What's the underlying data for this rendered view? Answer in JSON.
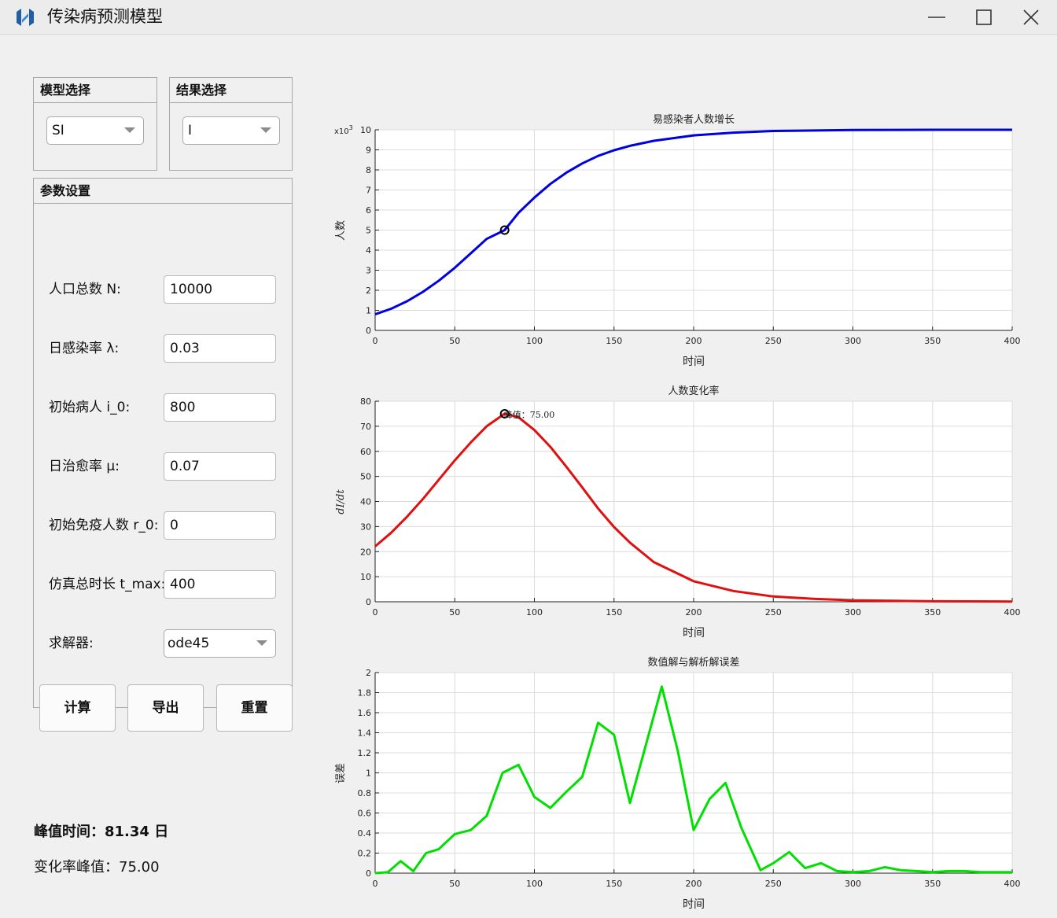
{
  "window": {
    "title": "传染病预测模型",
    "icon": "app-logo-icon"
  },
  "model_panel": {
    "title": "模型选择",
    "selected": "SI"
  },
  "result_panel": {
    "title": "结果选择",
    "selected": "I"
  },
  "params": {
    "title": "参数设置",
    "fields": [
      {
        "label": "人口总数 N:",
        "value": "10000"
      },
      {
        "label": "日感染率 λ:",
        "value": "0.03"
      },
      {
        "label": "初始病人 i_0:",
        "value": "800"
      },
      {
        "label": "日治愈率 μ:",
        "value": "0.07"
      },
      {
        "label": "初始免疫人数 r_0:",
        "value": "0"
      },
      {
        "label": "仿真总时长 t_max:",
        "value": "400"
      }
    ],
    "solver": {
      "label": "求解器:",
      "value": "ode45"
    }
  },
  "buttons": {
    "compute": "计算",
    "export": "导出",
    "reset": "重置"
  },
  "results": {
    "peak_time": "峰值时间：81.34 日",
    "peak_rate": "变化率峰值：75.00"
  },
  "colors": {
    "blue_line": "#0000e0",
    "red_line": "#e01010",
    "green_line": "#00e000",
    "grid": "#dcdcdc"
  },
  "chart_data": [
    {
      "type": "line",
      "title": "易感染者人数增长",
      "xlabel": "时间",
      "ylabel": "人数",
      "y_exponent": "x10",
      "y_exponent_power": "3",
      "xlim": [
        0,
        400
      ],
      "ylim": [
        0,
        10
      ],
      "xticks": [
        "0",
        "50",
        "100",
        "150",
        "200",
        "250",
        "300",
        "350",
        "400"
      ],
      "yticks": [
        "0",
        "1",
        "2",
        "3",
        "4",
        "5",
        "6",
        "7",
        "8",
        "9",
        "10"
      ],
      "grid": true,
      "series": [
        {
          "color": "#0000e0",
          "x": [
            0,
            10,
            20,
            30,
            40,
            50,
            60,
            70,
            81.34,
            90,
            100,
            110,
            120,
            130,
            140,
            150,
            160,
            175,
            200,
            225,
            250,
            300,
            350,
            400
          ],
          "y": [
            0.8,
            1.08,
            1.45,
            1.92,
            2.48,
            3.12,
            3.84,
            4.56,
            5.0,
            5.86,
            6.62,
            7.3,
            7.86,
            8.32,
            8.7,
            8.98,
            9.2,
            9.45,
            9.72,
            9.86,
            9.94,
            9.99,
            10.0,
            10.0
          ]
        }
      ],
      "marker": {
        "x": 81.34,
        "y": 5.0
      }
    },
    {
      "type": "line",
      "title": "人数变化率",
      "xlabel": "时间",
      "ylabel": "dI/dt",
      "xlim": [
        0,
        400
      ],
      "ylim": [
        0,
        80
      ],
      "xticks": [
        "0",
        "50",
        "100",
        "150",
        "200",
        "250",
        "300",
        "350",
        "400"
      ],
      "yticks": [
        "0",
        "10",
        "20",
        "30",
        "40",
        "50",
        "60",
        "70",
        "80"
      ],
      "grid": true,
      "series": [
        {
          "color": "#e01010",
          "x": [
            0,
            10,
            20,
            30,
            40,
            50,
            60,
            70,
            81.34,
            90,
            100,
            110,
            120,
            130,
            140,
            150,
            160,
            175,
            200,
            225,
            250,
            275,
            300,
            350,
            400
          ],
          "y": [
            22.1,
            27.5,
            33.9,
            41.0,
            48.7,
            56.4,
            63.5,
            70.0,
            75.0,
            73.6,
            68.5,
            61.8,
            53.9,
            45.6,
            37.2,
            29.8,
            23.6,
            15.8,
            8.2,
            4.3,
            2.1,
            1.2,
            0.6,
            0.2,
            0.1
          ]
        }
      ],
      "marker": {
        "x": 81.34,
        "y": 75.0
      },
      "annotation": "峰值：75.00"
    },
    {
      "type": "line",
      "title": "数值解与解析解误差",
      "xlabel": "时间",
      "ylabel": "误差",
      "xlim": [
        0,
        400
      ],
      "ylim": [
        0,
        2
      ],
      "xticks": [
        "0",
        "50",
        "100",
        "150",
        "200",
        "250",
        "300",
        "350",
        "400"
      ],
      "yticks": [
        "0",
        "0.2",
        "0.4",
        "0.6",
        "0.8",
        "1",
        "1.2",
        "1.4",
        "1.6",
        "1.8",
        "2"
      ],
      "grid": true,
      "series": [
        {
          "color": "#00e000",
          "x": [
            0,
            8,
            16,
            24,
            32,
            40,
            50,
            60,
            70,
            80,
            90,
            100,
            110,
            120,
            130,
            140,
            150,
            160,
            170,
            180,
            190,
            200,
            210,
            220,
            230,
            242,
            250,
            260,
            270,
            280,
            290,
            300,
            310,
            320,
            330,
            340,
            350,
            360,
            370,
            380,
            390,
            400
          ],
          "y": [
            0.0,
            0.01,
            0.12,
            0.02,
            0.2,
            0.24,
            0.39,
            0.43,
            0.57,
            1.0,
            1.08,
            0.76,
            0.65,
            0.81,
            0.96,
            1.5,
            1.38,
            0.7,
            1.28,
            1.86,
            1.22,
            0.43,
            0.74,
            0.9,
            0.45,
            0.03,
            0.1,
            0.21,
            0.05,
            0.1,
            0.02,
            0.01,
            0.02,
            0.06,
            0.03,
            0.02,
            0.01,
            0.02,
            0.02,
            0.01,
            0.01,
            0.01
          ]
        }
      ]
    }
  ]
}
